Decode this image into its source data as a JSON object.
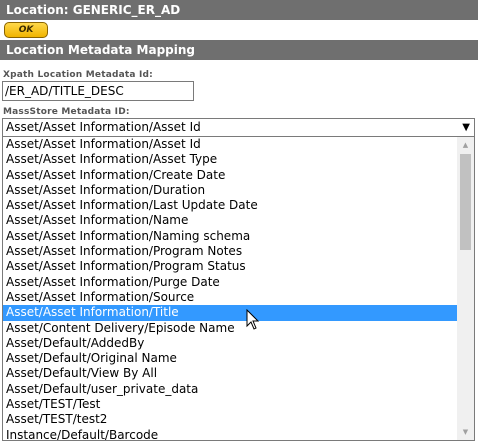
{
  "header": {
    "title": "Location: GENERIC_ER_AD"
  },
  "ok_button": {
    "label": "OK"
  },
  "section": {
    "title": "Location Metadata Mapping"
  },
  "xpath_field": {
    "label": "Xpath Location Metadata Id:",
    "value": "/ER_AD/TITLE_DESC"
  },
  "massstore_field": {
    "label": "MassStore Metadata ID:",
    "selected": "Asset/Asset Information/Asset Id",
    "chevron": "▼"
  },
  "dropdown": {
    "highlighted": "Asset/Asset Information/Title",
    "options": [
      "Asset/Asset Information/Asset Id",
      "Asset/Asset Information/Asset Type",
      "Asset/Asset Information/Create Date",
      "Asset/Asset Information/Duration",
      "Asset/Asset Information/Last Update Date",
      "Asset/Asset Information/Name",
      "Asset/Asset Information/Naming schema",
      "Asset/Asset Information/Program Notes",
      "Asset/Asset Information/Program Status",
      "Asset/Asset Information/Purge Date",
      "Asset/Asset Information/Source",
      "Asset/Asset Information/Title",
      "Asset/Content Delivery/Episode Name",
      "Asset/Default/AddedBy",
      "Asset/Default/Original Name",
      "Asset/Default/View By All",
      "Asset/Default/user_private_data",
      "Asset/TEST/Test",
      "Asset/TEST/test2",
      "Instance/Default/Barcode"
    ],
    "scroll_up_icon": "▲",
    "scroll_down_icon": "▼"
  }
}
